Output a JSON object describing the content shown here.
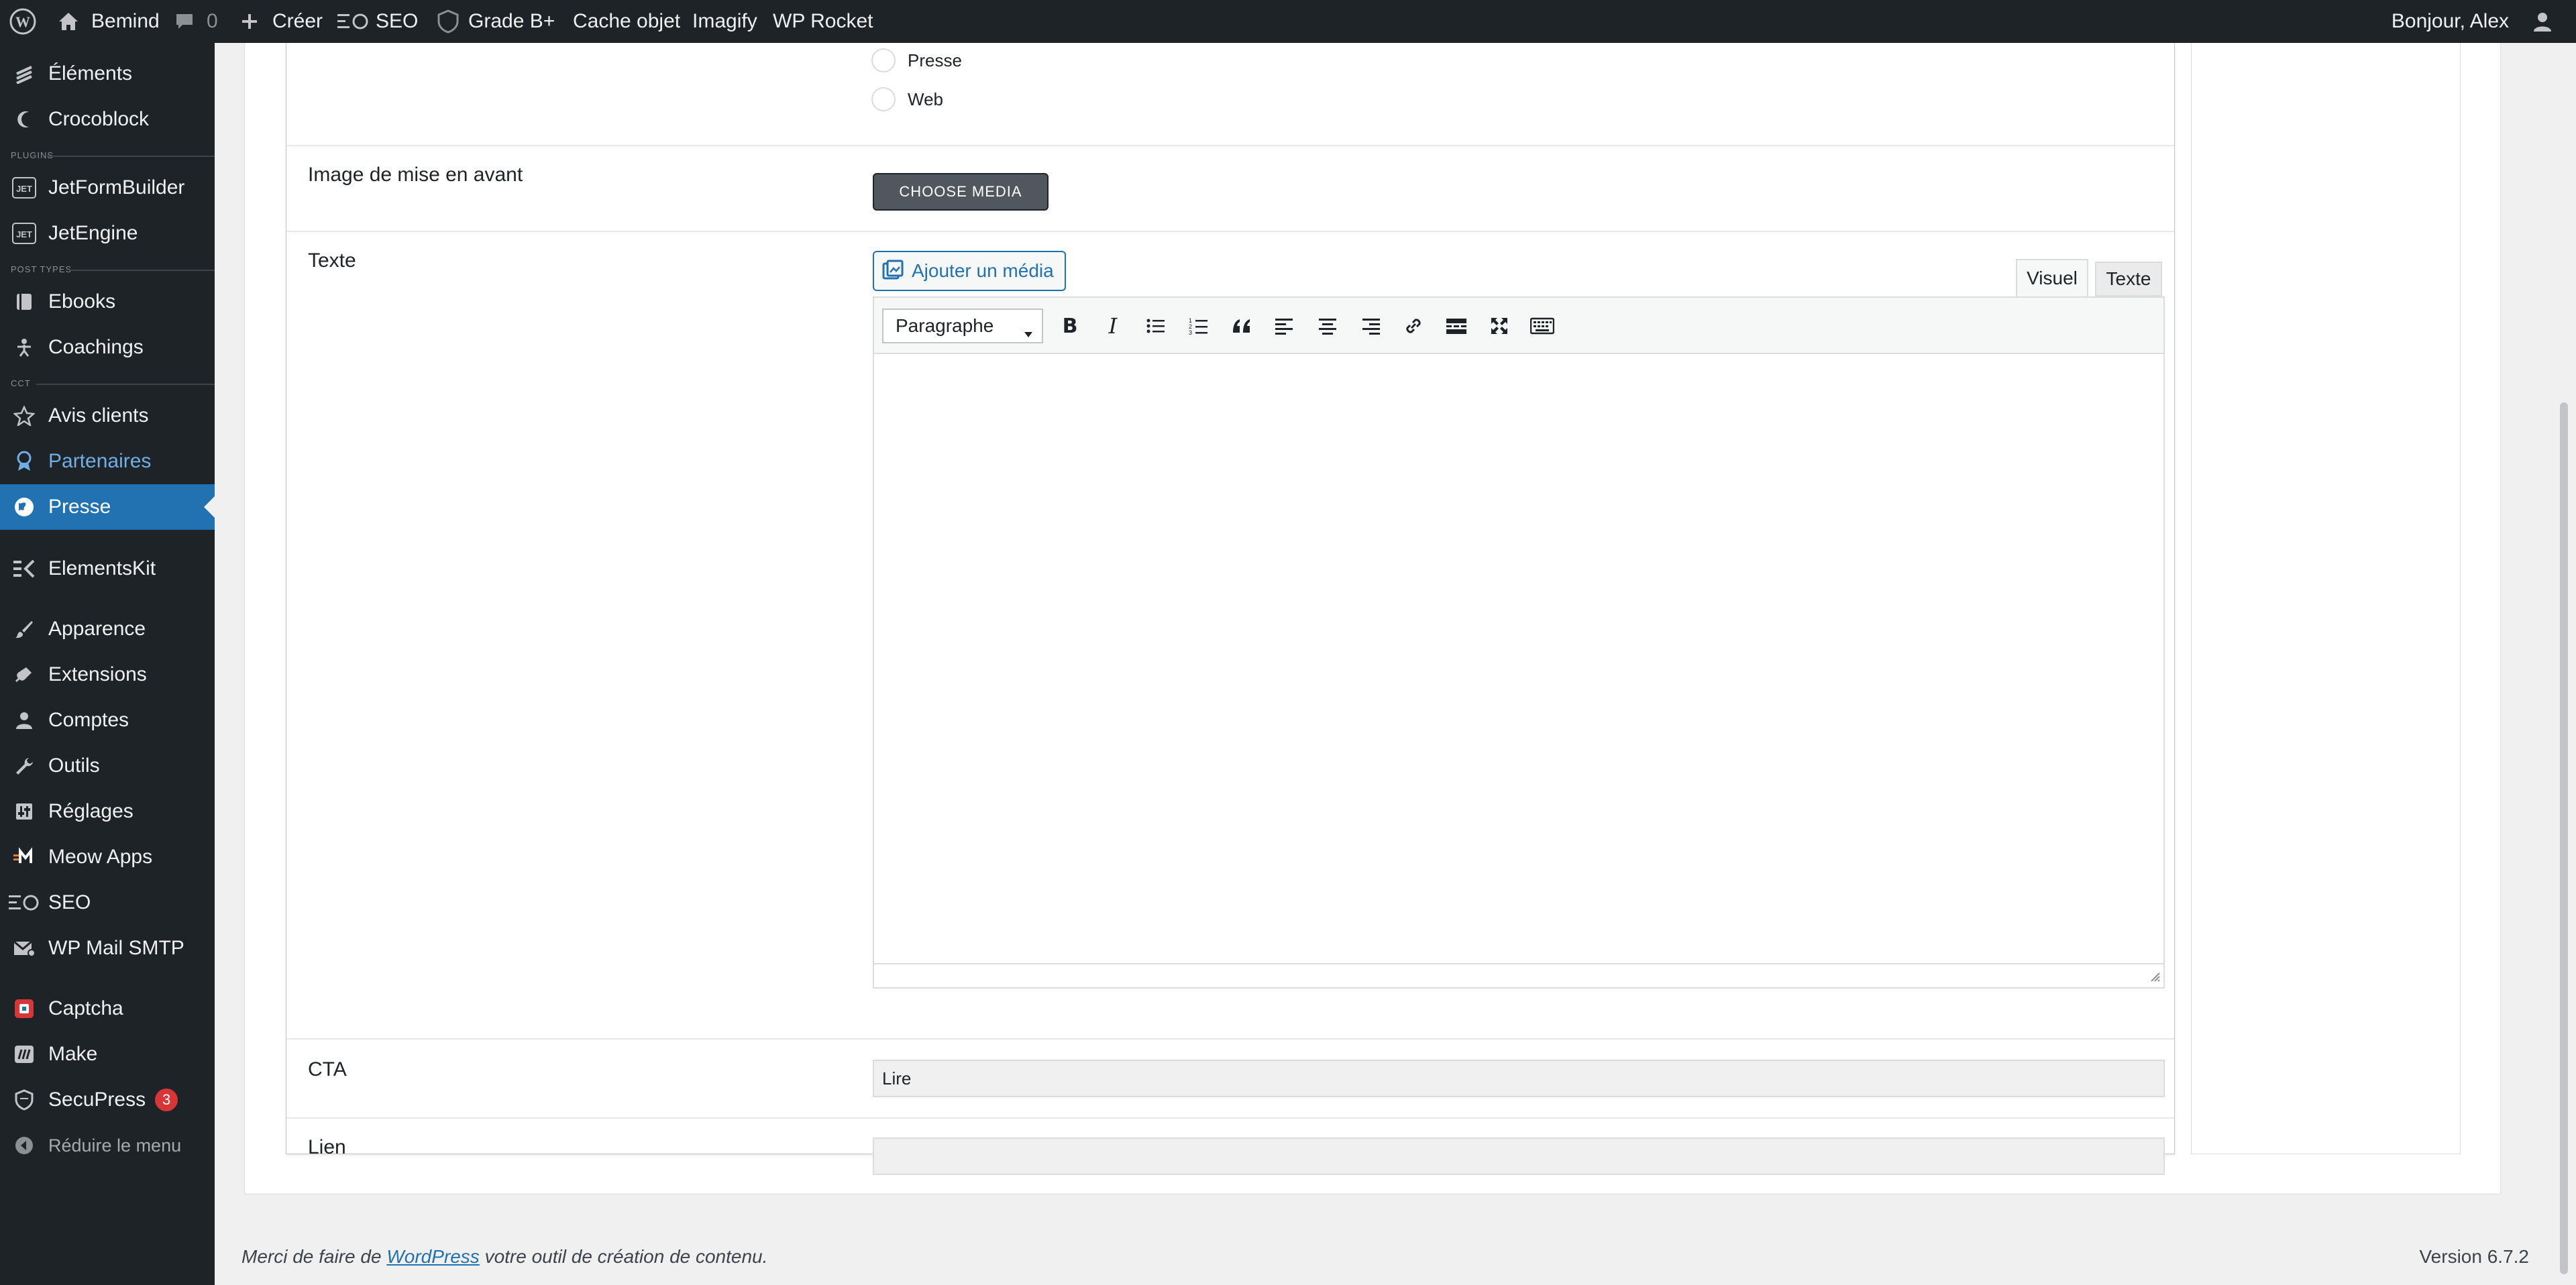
{
  "adminbar": {
    "site_name": "Bemind",
    "comments_count": "0",
    "new_label": "Créer",
    "seo_label": "SEO",
    "grade_label": "Grade B+",
    "cache_label": "Cache objet",
    "imagify_label": "Imagify",
    "rocket_label": "WP Rocket",
    "greeting": "Bonjour, Alex"
  },
  "sidebar": {
    "section_plugins": "PLUGINS",
    "section_post_types": "POST TYPES",
    "section_cct": "CCT",
    "items": [
      {
        "label": "Éléments",
        "icon": "elementor-icon"
      },
      {
        "label": "Crocoblock",
        "icon": "crocoblock-icon"
      },
      {
        "label": "JetFormBuilder",
        "icon": "jet-icon"
      },
      {
        "label": "JetEngine",
        "icon": "jet-icon"
      },
      {
        "label": "Ebooks",
        "icon": "book-icon"
      },
      {
        "label": "Coachings",
        "icon": "person-icon"
      },
      {
        "label": "Avis clients",
        "icon": "star-icon"
      },
      {
        "label": "Partenaires",
        "icon": "award-icon"
      },
      {
        "label": "Presse",
        "icon": "globe-icon"
      },
      {
        "label": "ElementsKit",
        "icon": "ek-icon"
      },
      {
        "label": "Apparence",
        "icon": "brush-icon"
      },
      {
        "label": "Extensions",
        "icon": "plugin-icon"
      },
      {
        "label": "Comptes",
        "icon": "user-icon"
      },
      {
        "label": "Outils",
        "icon": "wrench-icon"
      },
      {
        "label": "Réglages",
        "icon": "settings-icon"
      },
      {
        "label": "Meow Apps",
        "icon": "meow-icon"
      },
      {
        "label": "SEO",
        "icon": "seo-icon"
      },
      {
        "label": "WP Mail SMTP",
        "icon": "mail-icon"
      },
      {
        "label": "Captcha",
        "icon": "captcha-icon"
      },
      {
        "label": "Make",
        "icon": "make-icon"
      },
      {
        "label": "SecuPress",
        "icon": "shield-icon",
        "badge": "3"
      }
    ],
    "collapse_label": "Réduire le menu"
  },
  "form": {
    "radio_options": [
      "Presse",
      "Web"
    ],
    "featured_image_label": "Image de mise en avant",
    "choose_media_label": "CHOOSE MEDIA",
    "text_label": "Texte",
    "add_media_label": "Ajouter un média",
    "tab_visual": "Visuel",
    "tab_text": "Texte",
    "format_select": "Paragraphe",
    "cta_label": "CTA",
    "cta_value": "Lire",
    "link_label": "Lien",
    "link_value": ""
  },
  "footer": {
    "text_before": "Merci de faire de ",
    "link": "WordPress",
    "text_after": " votre outil de création de contenu.",
    "version": "Version 6.7.2"
  },
  "colors": {
    "accent": "#2271b1",
    "admin_bg": "#1d2327",
    "badge": "#d63638"
  }
}
